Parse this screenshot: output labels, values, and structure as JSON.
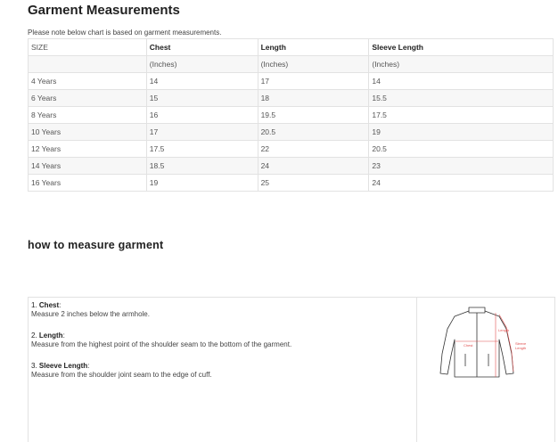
{
  "title": "Garment Measurements",
  "note": "Please note below chart is based on garment measurements.",
  "table": {
    "headers": [
      "SIZE",
      "Chest",
      "Length",
      "Sleeve Length"
    ],
    "units": [
      "",
      "(Inches)",
      "(Inches)",
      "(Inches)"
    ],
    "rows": [
      [
        "4 Years",
        "14",
        "17",
        "14"
      ],
      [
        "6 Years",
        "15",
        "18",
        "15.5"
      ],
      [
        "8 Years",
        "16",
        "19.5",
        "17.5"
      ],
      [
        "10 Years",
        "17",
        "20.5",
        "19"
      ],
      [
        "12 Years",
        "17.5",
        "22",
        "20.5"
      ],
      [
        "14 Years",
        "18.5",
        "24",
        "23"
      ],
      [
        "16 Years",
        "19",
        "25",
        "24"
      ]
    ]
  },
  "how_title": "how to measure garment",
  "steps": [
    {
      "num": "1.",
      "label": "Chest",
      "text": "Measure 2 inches below the armhole."
    },
    {
      "num": "2.",
      "label": "Length",
      "text": "Measure from the highest point of the shoulder seam to the bottom of the garment."
    },
    {
      "num": "3.",
      "label": "Sleeve Length",
      "text": "Measure from the shoulder joint seam to the edge of cuff."
    }
  ],
  "diagram": {
    "labels": {
      "chest": "Chest",
      "length": "Length",
      "sleeve": "Sleeve Length"
    },
    "accent": "#e05050",
    "icon": "jacket-icon"
  }
}
